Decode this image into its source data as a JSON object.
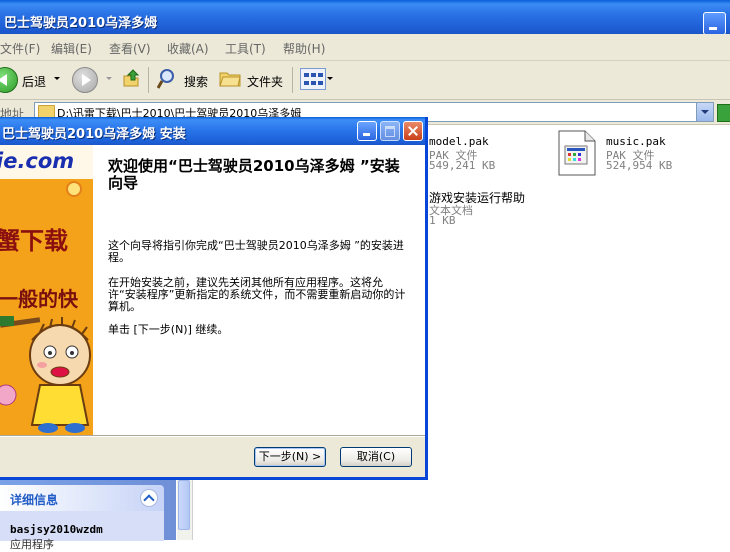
{
  "explorer": {
    "title": "巴士驾驶员2010乌泽多姆",
    "menu": [
      "文件(F)",
      "编辑(E)",
      "查看(V)",
      "收藏(A)",
      "工具(T)",
      "帮助(H)"
    ],
    "toolbar": {
      "back": "后退",
      "search": "搜索",
      "folders": "文件夹"
    },
    "address_label": "地址",
    "address_value": "D:\\迅雷下载\\巴士2010\\巴士驾驶员2010乌泽多姆"
  },
  "files": [
    {
      "name": "model.pak",
      "type": "PAK 文件",
      "size": "549,241 KB"
    },
    {
      "name": "music.pak",
      "type": "PAK 文件",
      "size": "524,954 KB"
    },
    {
      "name": "游戏安装运行帮助",
      "type": "文本文档",
      "size": "1 KB"
    }
  ],
  "details_pane": {
    "title": "详细信息",
    "selected_name": "basjsy2010wzdm",
    "selected_type": "应用程序"
  },
  "dialog": {
    "title": "巴士驾驶员2010乌泽多姆  安装",
    "heading": "欢迎使用“巴士驾驶员2010乌泽多姆 ”安装向导",
    "para1": "这个向导将指引你完成“巴士驾驶员2010乌泽多姆 ”的安装进程。",
    "para2": "在开始安装之前，建议先关闭其他所有应用程序。这将允许“安装程序”更新指定的系统文件，而不需要重新启动你的计算机。",
    "para3": "单击 [下一步(N)] 继续。",
    "next_label": "下一步(N) >",
    "cancel_label": "取消(C)",
    "banner": {
      "logo": "ie.com",
      "line1": "蟹下载",
      "line2": "一般的快"
    }
  }
}
